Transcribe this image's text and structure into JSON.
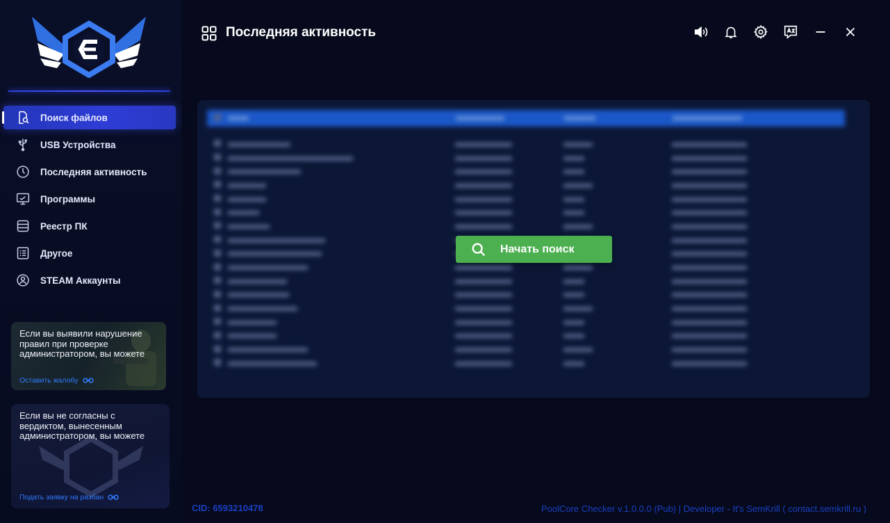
{
  "sidebar": {
    "items": [
      {
        "label": "Поиск файлов",
        "icon": "file-search-icon",
        "active": true
      },
      {
        "label": "USB Устройства",
        "icon": "usb-icon",
        "active": false
      },
      {
        "label": "Последняя активность",
        "icon": "clock-icon",
        "active": false
      },
      {
        "label": "Программы",
        "icon": "monitor-icon",
        "active": false
      },
      {
        "label": "Реестр ПК",
        "icon": "registry-icon",
        "active": false
      },
      {
        "label": "Другое",
        "icon": "list-icon",
        "active": false
      },
      {
        "label": "STEAM Аккаунты",
        "icon": "steam-icon",
        "active": false
      }
    ],
    "cards": [
      {
        "text": "Если вы выявили нарушение правил при проверке администратором, вы можете",
        "link": "Оставить жалобу"
      },
      {
        "text": "Если вы не согласны с вердиктом, вынесенным администратором, вы можете",
        "link": "Подать заявку на разбан"
      }
    ]
  },
  "header": {
    "title": "Последняя активность",
    "icons": [
      "volume-icon",
      "bell-icon",
      "settings-icon",
      "translate-icon",
      "minimize-icon",
      "close-icon"
    ]
  },
  "main": {
    "start_button": "Начать поиск"
  },
  "footer": {
    "cid": "CID: 6593210478",
    "info": "PoolCore Checker v.1.0.0.0 (Pub) | Developer - It's SemKrill ( contact.semkrill.ru )"
  },
  "colors": {
    "accent": "#2e3dd6",
    "button": "#4caf50",
    "footer_text": "#1b3fc2",
    "background": "#060a1c"
  }
}
